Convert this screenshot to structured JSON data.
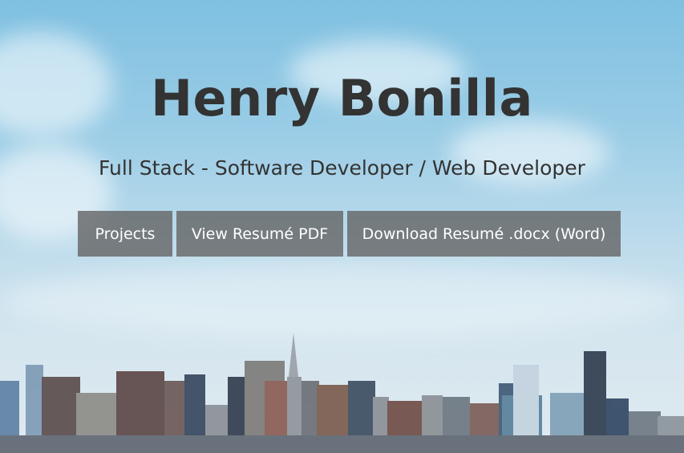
{
  "hero": {
    "title": "Henry Bonilla",
    "subtitle": "Full Stack - Software Developer / Web Developer"
  },
  "buttons": {
    "projects": "Projects",
    "view_pdf": "View Resumé PDF",
    "download_docx": "Download Resumé .docx (Word)"
  },
  "colors": {
    "text": "#333333",
    "button_bg": "rgba(100,100,100,0.80)",
    "button_text": "#ffffff"
  }
}
